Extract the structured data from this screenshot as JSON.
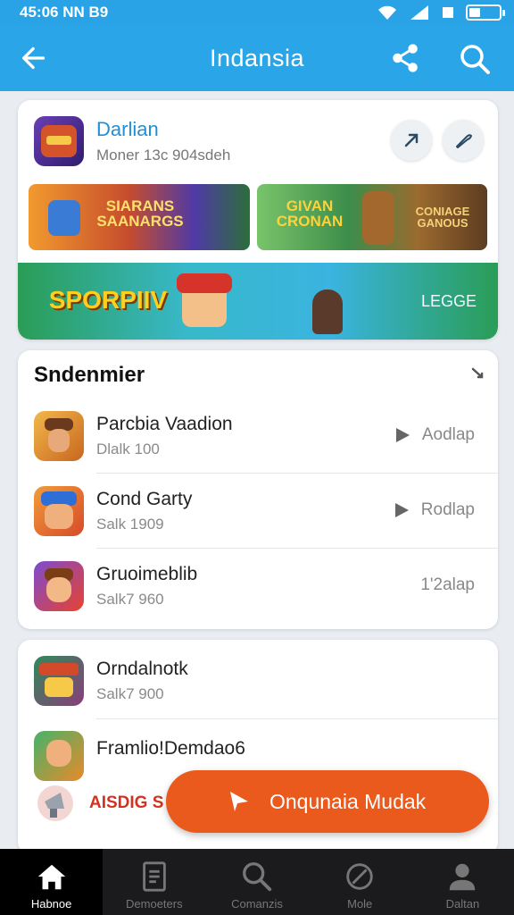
{
  "status_bar": {
    "time": "45:06 NN B9"
  },
  "app_bar": {
    "title": "Indansia"
  },
  "featured": {
    "title": "Darlian",
    "subtitle": "Moner 13c 904sdeh",
    "banners": [
      {
        "text": "SIARANS SAANARGS"
      },
      {
        "text": "GIVAN CRONAN"
      },
      {
        "text": "CONIAGE GANOUS"
      },
      {
        "text": "SPORPIIV"
      },
      {
        "text": "LEGGE"
      }
    ]
  },
  "recommendations": {
    "title": "Sndenmier",
    "items": [
      {
        "name": "Parcbia Vaadion",
        "meta": "Dlalk 100",
        "action": "Aodlap"
      },
      {
        "name": "Cond Garty",
        "meta": "Salk 1909",
        "action": "Rodlap"
      },
      {
        "name": "Gruoimeblib",
        "meta": "Salk7 960",
        "action": "1'2alap"
      }
    ]
  },
  "more": {
    "items": [
      {
        "name": "Orndalnotk",
        "meta": "Salk7 900"
      },
      {
        "name": "Framlio!Demdao6"
      },
      {
        "name": "AISDIG S"
      }
    ]
  },
  "fab": {
    "label": "Onqunaia Mudak"
  },
  "bottom_nav": {
    "items": [
      {
        "label": "Habnoe",
        "icon": "home-icon",
        "active": true
      },
      {
        "label": "Demoeters",
        "icon": "document-icon"
      },
      {
        "label": "Comanzis",
        "icon": "search-icon"
      },
      {
        "label": "Mole",
        "icon": "compass-icon"
      },
      {
        "label": "Daltan",
        "icon": "profile-icon"
      }
    ]
  },
  "colors": {
    "accent": "#2aa6e8",
    "fab": "#ea5a1c",
    "link": "#1f8fd6",
    "nav_bg": "#1b1b1d"
  }
}
